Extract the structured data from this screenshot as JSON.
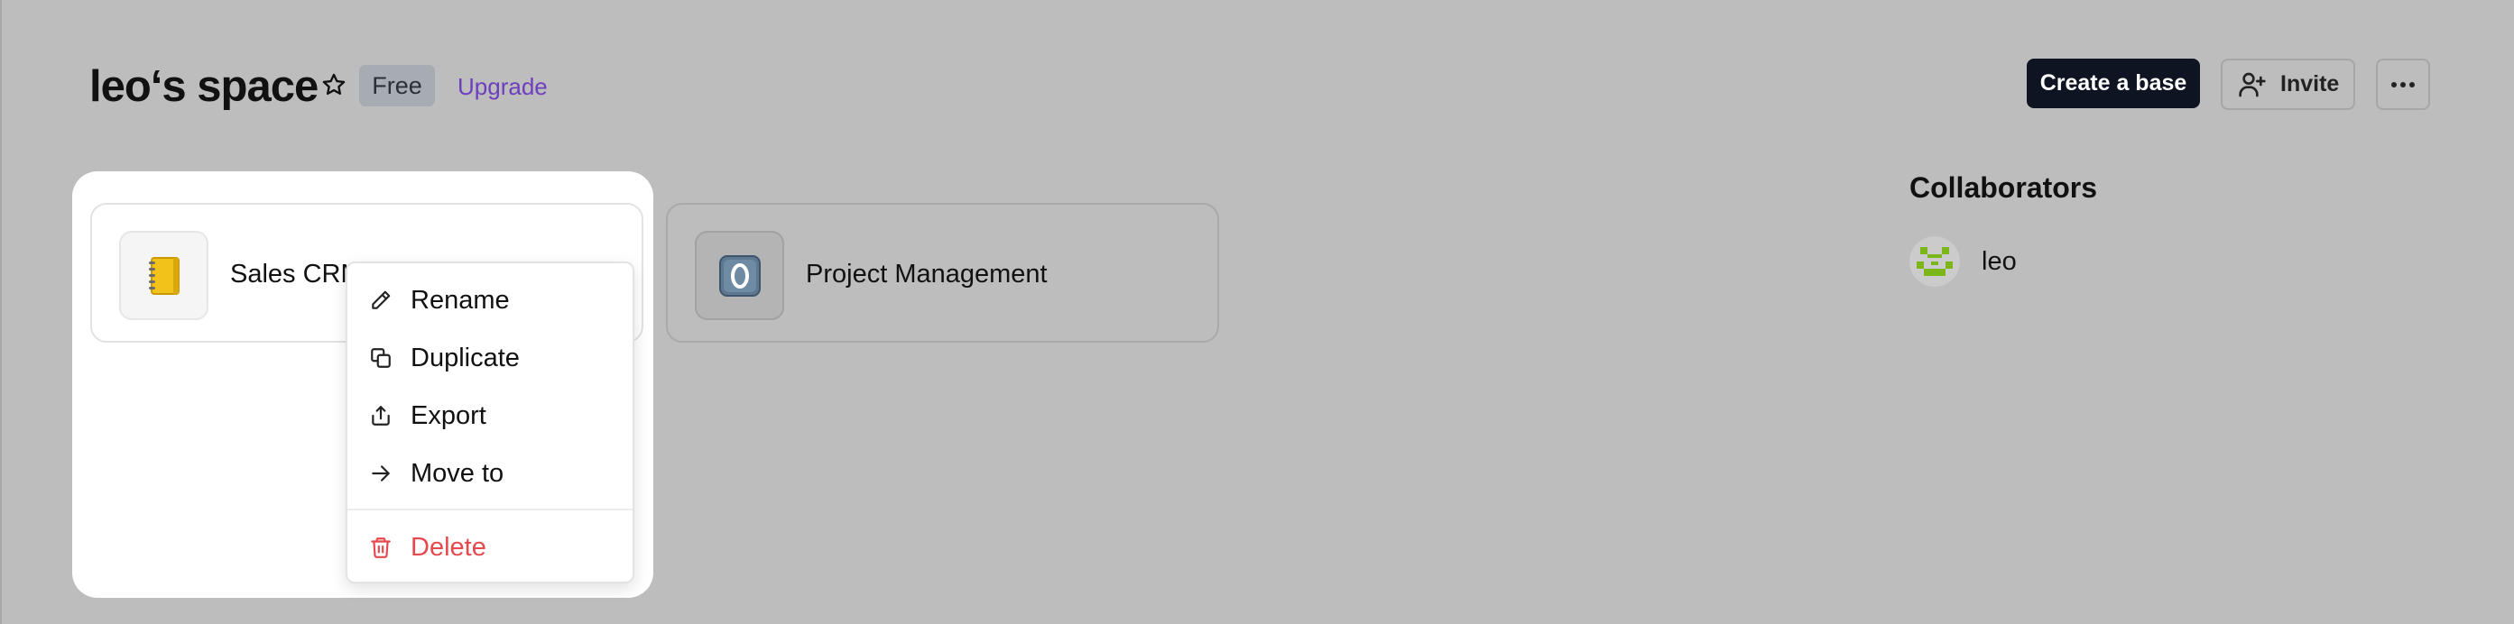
{
  "header": {
    "space_title": "leo‘s space",
    "plan_badge": "Free",
    "upgrade_link": "Upgrade",
    "create_base_button": "Create a base",
    "invite_button": "Invite"
  },
  "bases": [
    {
      "name": "Sales CRM",
      "icon": "notebook-emoji",
      "icon_color": "#f2c21b"
    },
    {
      "name": "Project Management",
      "icon": "zero-keycap-emoji",
      "icon_color": "#5e7891"
    }
  ],
  "collaborators": {
    "heading": "Collaborators",
    "people": [
      {
        "name": "leo",
        "avatar": "pixel-face-avatar",
        "avatar_color": "#7cb518"
      }
    ]
  },
  "context_menu": {
    "items": [
      {
        "label": "Rename",
        "icon": "pencil-icon"
      },
      {
        "label": "Duplicate",
        "icon": "copy-icon"
      },
      {
        "label": "Export",
        "icon": "share-upload-icon"
      },
      {
        "label": "Move to",
        "icon": "arrow-right-icon"
      },
      {
        "label": "Delete",
        "icon": "trash-icon",
        "danger": true
      }
    ]
  },
  "colors": {
    "overlay_background": "#bdbdbd",
    "primary_button": "#0e1421",
    "upgrade_link": "#6d3fbf",
    "danger": "#e5484d"
  }
}
